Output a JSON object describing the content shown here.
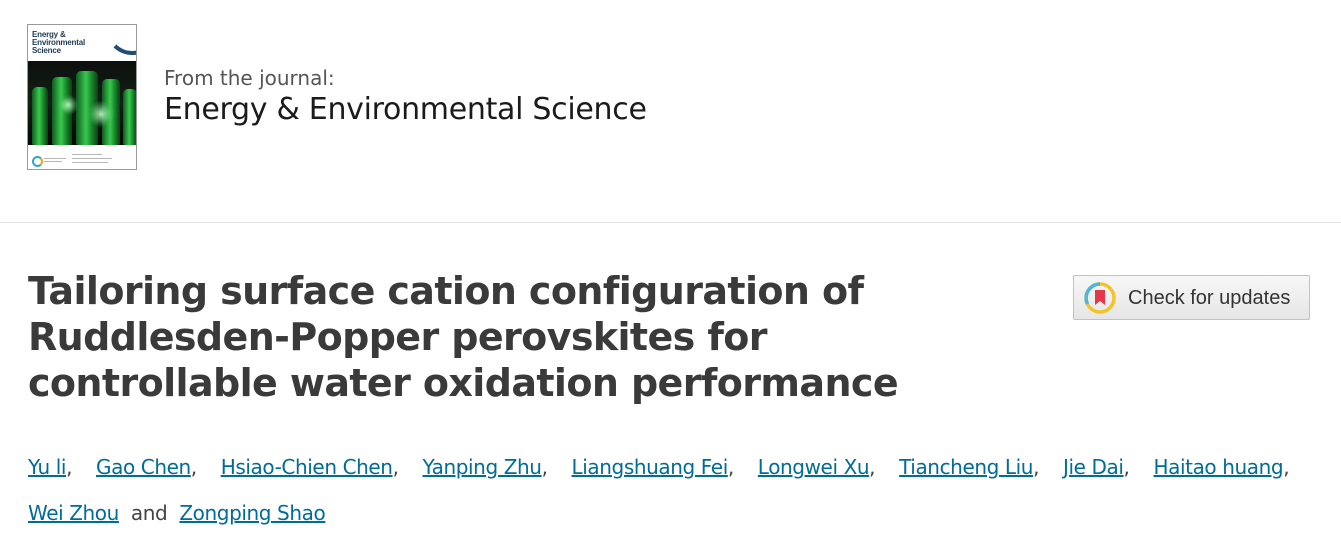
{
  "journal": {
    "cover_title": "Energy & Environmental Science",
    "from_label": "From the journal:",
    "name": "Energy & Environmental Science"
  },
  "article": {
    "title": "Tailoring surface cation configuration of Ruddlesden-Popper perovskites for controllable water oxidation performance"
  },
  "updates_button": {
    "label": "Check for updates"
  },
  "authors": {
    "names": [
      "Yu li",
      "Gao Chen",
      "Hsiao-Chien Chen",
      "Yanping Zhu",
      "Liangshuang Fei",
      "Longwei Xu",
      "Tiancheng Liu",
      "Jie Dai",
      "Haitao huang",
      "Wei Zhou",
      "Zongping Shao"
    ],
    "separator": ",",
    "conjunction": "and"
  },
  "colors": {
    "link": "#006c98",
    "title": "#3a3a3a",
    "divider": "#e2e2e2"
  },
  "icons": {
    "updates": "crossmark-bookmark-icon"
  }
}
